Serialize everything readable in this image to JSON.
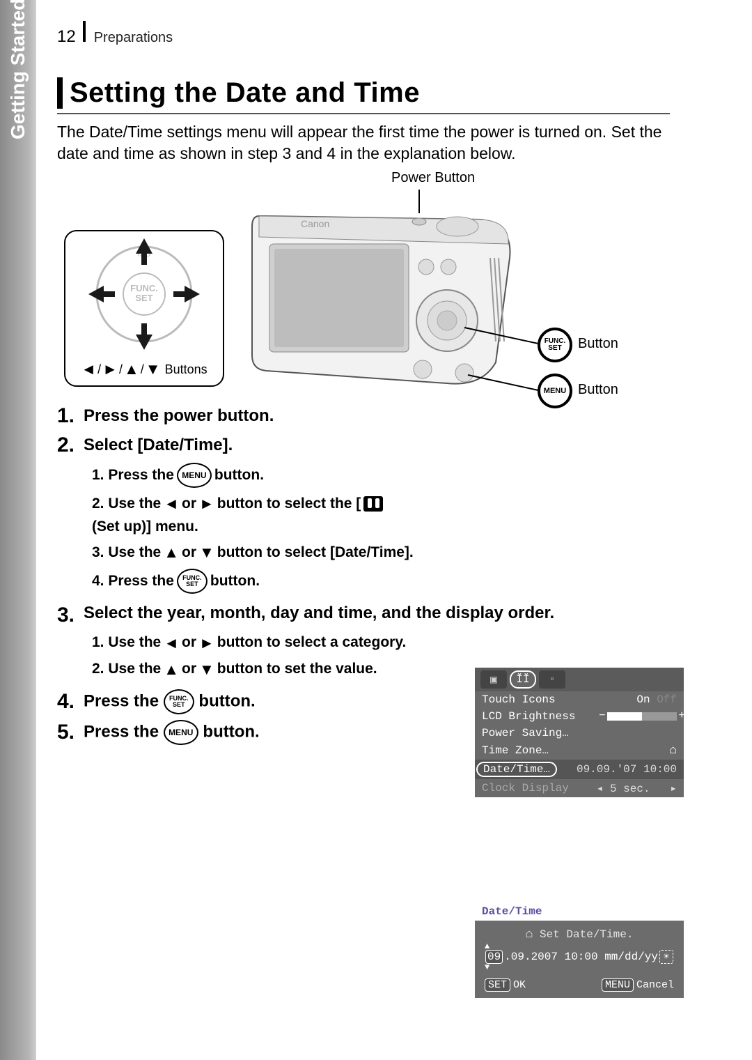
{
  "header": {
    "page_number": "12",
    "chapter": "Preparations"
  },
  "side_tab": "Getting Started",
  "section": {
    "title": "Setting the Date and Time",
    "intro": "The Date/Time settings menu will appear the first time the power is turned on. Set the date and time as shown in step 3 and 4 in the explanation below."
  },
  "diagram": {
    "power_button_label": "Power Button",
    "func_set_button_label": "Button",
    "menu_button_label": "Button",
    "dpad_buttons_label": "Buttons",
    "func_top": "FUNC.",
    "func_bottom": "SET",
    "menu_text": "MENU",
    "dpad_center_top": "FUNC.",
    "dpad_center_bottom": "SET",
    "dpad_iso": "ISO"
  },
  "menu_screen": {
    "rows": {
      "touch_icons": {
        "label": "Touch Icons",
        "on": "On",
        "off": "Off"
      },
      "lcd_brightness": {
        "label": "LCD Brightness"
      },
      "power_saving": {
        "label": "Power Saving…"
      },
      "time_zone": {
        "label": "Time Zone…"
      },
      "date_time": {
        "label": "Date/Time…",
        "value": "09.09.'07 10:00"
      },
      "clock_display": {
        "label": "Clock Display",
        "value": "5 sec."
      }
    }
  },
  "datetime_screen": {
    "title": "Date/Time",
    "subtitle": "Set Date/Time.",
    "month": "09",
    "rest": ".09.2007 10:00 mm/dd/yy",
    "set_label": "SET",
    "ok": "OK",
    "menu_label": "MENU",
    "cancel": "Cancel"
  },
  "steps": {
    "s1": "Press the power button.",
    "s2": "Select [Date/Time].",
    "s2_sub": {
      "a_pre": "1. Press the ",
      "a_post": " button.",
      "b_pre": "2. Use the ",
      "b_mid": " or ",
      "b_post": " button to select the [",
      "b_end": " (Set up)] menu.",
      "c_pre": "3. Use the ",
      "c_mid": " or ",
      "c_post": " button to select [Date/Time].",
      "d_pre": "4. Press the ",
      "d_post": " button."
    },
    "s3": "Select the year, month, day and time, and the display order.",
    "s3_sub": {
      "a_pre": "1. Use the ",
      "a_mid": " or ",
      "a_post": " button to select a category.",
      "b_pre": "2. Use the ",
      "b_mid": " or ",
      "b_post": " button to set the value."
    },
    "s4_pre": "Press the ",
    "s4_post": " button.",
    "s5_pre": "Press the ",
    "s5_post": " button."
  },
  "nums": {
    "n1": "1.",
    "n2": "2.",
    "n3": "3.",
    "n4": "4.",
    "n5": "5."
  }
}
